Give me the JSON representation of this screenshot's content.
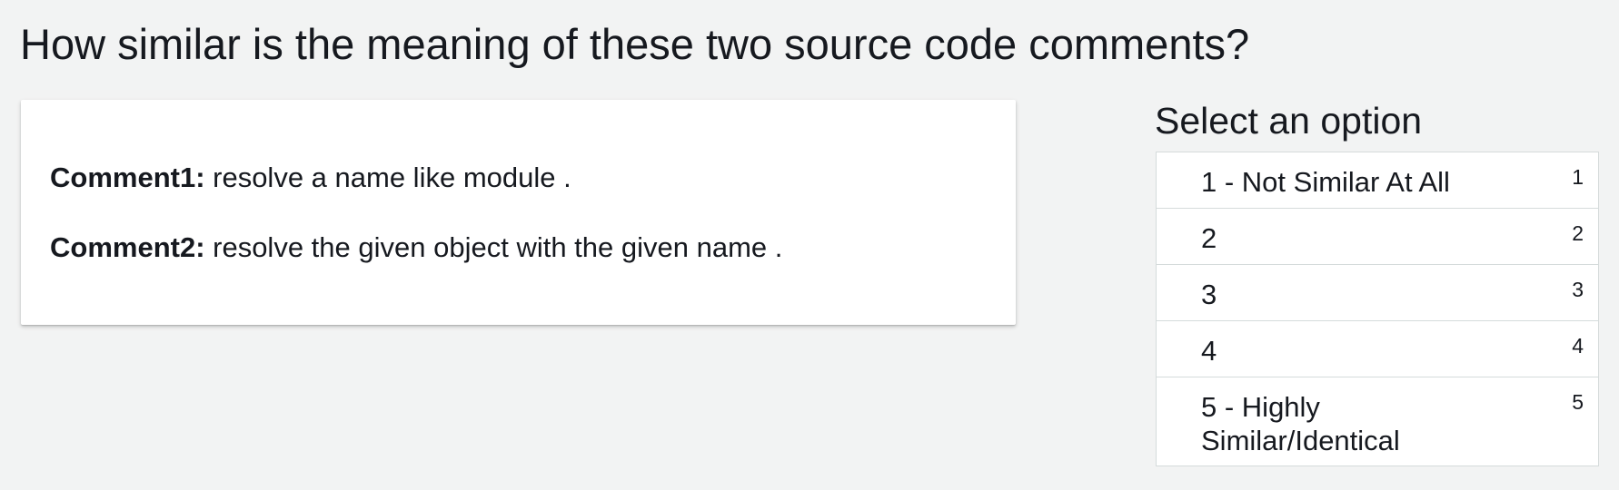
{
  "question": "How similar is the meaning of these two source code comments?",
  "comments": [
    {
      "label": "Comment1:",
      "text": " resolve a name like module ."
    },
    {
      "label": "Comment2:",
      "text": " resolve the given object with the given name ."
    }
  ],
  "options_title": "Select an option",
  "options": [
    {
      "label": "1 - Not Similar At All",
      "shortcut": "1"
    },
    {
      "label": "2",
      "shortcut": "2"
    },
    {
      "label": "3",
      "shortcut": "3"
    },
    {
      "label": "4",
      "shortcut": "4"
    },
    {
      "label": "5 - Highly Similar/Identical",
      "shortcut": "5"
    }
  ]
}
